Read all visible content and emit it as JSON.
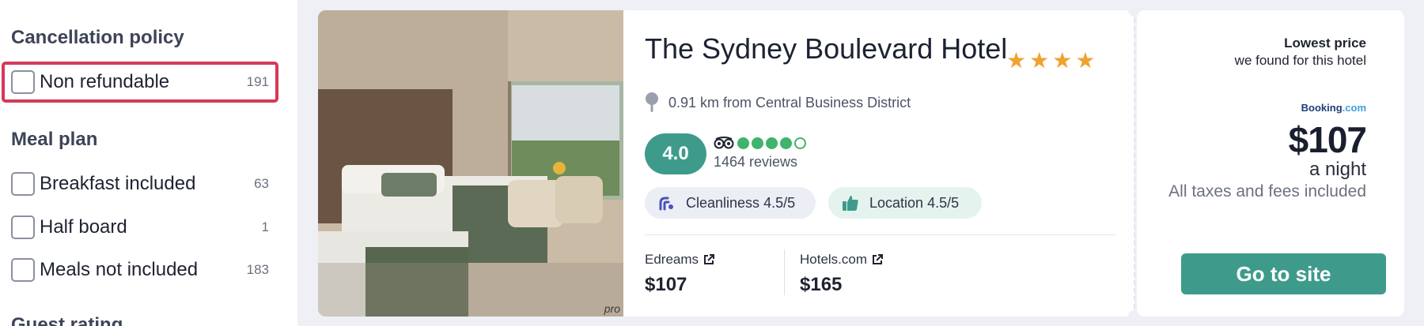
{
  "sidebar": {
    "cancellation": {
      "title": "Cancellation policy",
      "options": [
        {
          "label": "Non refundable",
          "count": "191",
          "highlighted": true
        }
      ]
    },
    "meal_plan": {
      "title": "Meal plan",
      "options": [
        {
          "label": "Breakfast included",
          "count": "63"
        },
        {
          "label": "Half board",
          "count": "1"
        },
        {
          "label": "Meals not included",
          "count": "183"
        }
      ]
    },
    "guest_rating": {
      "title": "Guest rating"
    }
  },
  "hotel": {
    "name": "The Sydney Boulevard Hotel",
    "stars": 4,
    "location": "0.91 km from Central Business District",
    "rating": "4.0",
    "tripadvisor_bubbles": 4,
    "reviews": "1464 reviews",
    "photo_credit": "pro",
    "chips": {
      "cleanliness": {
        "label": "Cleanliness",
        "score": "4.5",
        "of": "/5"
      },
      "location": {
        "label": "Location",
        "score": "4.5",
        "of": "/5"
      }
    },
    "providers": [
      {
        "name": "Edreams",
        "price": "$107"
      },
      {
        "name": "Hotels.com",
        "price": "$165"
      }
    ]
  },
  "price_panel": {
    "title": "Lowest price",
    "subtitle": "we found for this hotel",
    "provider_logo": "Booking",
    "provider_logo_suffix": ".com",
    "price": "$107",
    "per": "a night",
    "taxes": "All taxes and fees included",
    "cta": "Go to site"
  },
  "colors": {
    "accent": "#3e9b8b",
    "highlight_border": "#d33a59",
    "star": "#f0a22f",
    "tripadvisor": "#3fb46a"
  }
}
